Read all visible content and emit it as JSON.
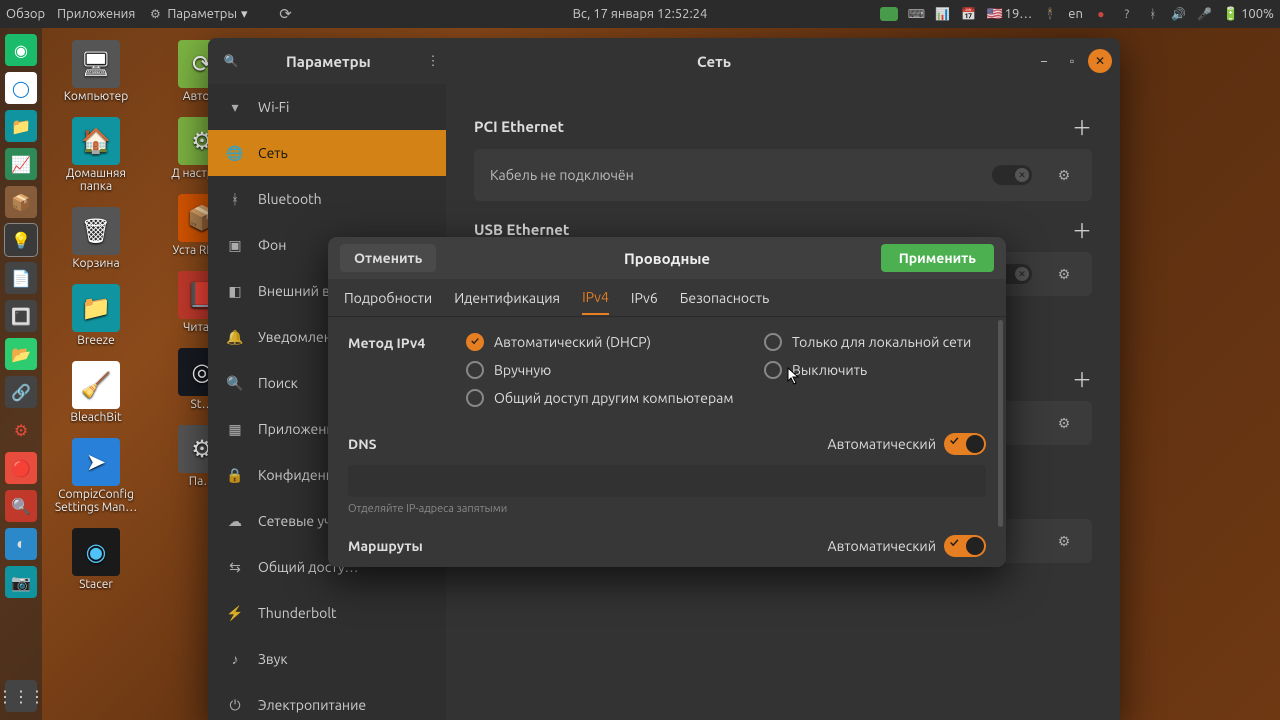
{
  "panel": {
    "overview": "Обзор",
    "applications": "Приложения",
    "parameters": "Параметры",
    "datetime": "Вс, 17 января  12:52:24",
    "temp": "19…",
    "lang": "en",
    "battery": "100%"
  },
  "desktop": {
    "col1": [
      "Компьютер",
      "Домашняя папка",
      "Корзина",
      "Breeze",
      "BleachBit",
      "CompizConfig Settings Man…",
      "Stacer"
    ],
    "col2": [
      "Авто…",
      "Д настро…",
      "Уста REL…",
      "Чита…",
      "St…",
      "Па…"
    ]
  },
  "window": {
    "title_left": "Параметры",
    "title_center": "Сеть",
    "sidebar": [
      "Wi-Fi",
      "Сеть",
      "Bluetooth",
      "Фон",
      "Внешний ви…",
      "Уведомлени…",
      "Поиск",
      "Приложени…",
      "Конфиденц…",
      "Сетевые учё…",
      "Общий досту…",
      "Thunderbolt",
      "Звук",
      "Электропитание"
    ],
    "net": {
      "pci": "PCI Ethernet",
      "cable": "Кабель не подключён",
      "usb": "USB Ethernet"
    }
  },
  "dialog": {
    "cancel": "Отменить",
    "title": "Проводные",
    "apply": "Применить",
    "tabs": [
      "Подробности",
      "Идентификация",
      "IPv4",
      "IPv6",
      "Безопасность"
    ],
    "method_label": "Метод IPv4",
    "radios": {
      "dhcp": "Автоматический (DHCP)",
      "local": "Только для локальной сети",
      "manual": "Вручную",
      "disable": "Выключить",
      "shared": "Общий доступ другим компьютерам"
    },
    "dns_label": "DNS",
    "auto": "Автоматический",
    "hint": "Отделяйте IP-адреса запятыми",
    "routes_label": "Маршруты"
  }
}
